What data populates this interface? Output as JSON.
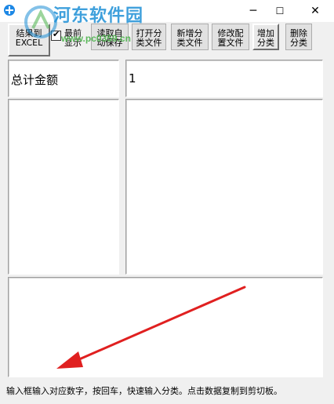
{
  "watermark": {
    "title": "河东软件园",
    "url": "www.pc0359.cn"
  },
  "window": {
    "minimize": "─",
    "maximize": "☐",
    "close": "✕"
  },
  "toolbar": {
    "export_button": "结果到\nEXCEL",
    "latest_checkbox": {
      "label": "最前\n显示",
      "checked": true
    },
    "buttons": [
      "读取自\n动保存",
      "打开分\n类文件",
      "新增分\n类文件",
      "修改配\n置文件",
      "增加\n分类",
      "删除\n分类"
    ]
  },
  "fields": {
    "total_label": "总计金额",
    "total_value": "1"
  },
  "status": {
    "hint": "输入框输入对应数字，按回车，快速输入分类。点击数据复制到剪切板。"
  },
  "colors": {
    "arrow": "#e02020",
    "watermark_blue": "#1e90d6",
    "watermark_green": "#4cb34c"
  }
}
